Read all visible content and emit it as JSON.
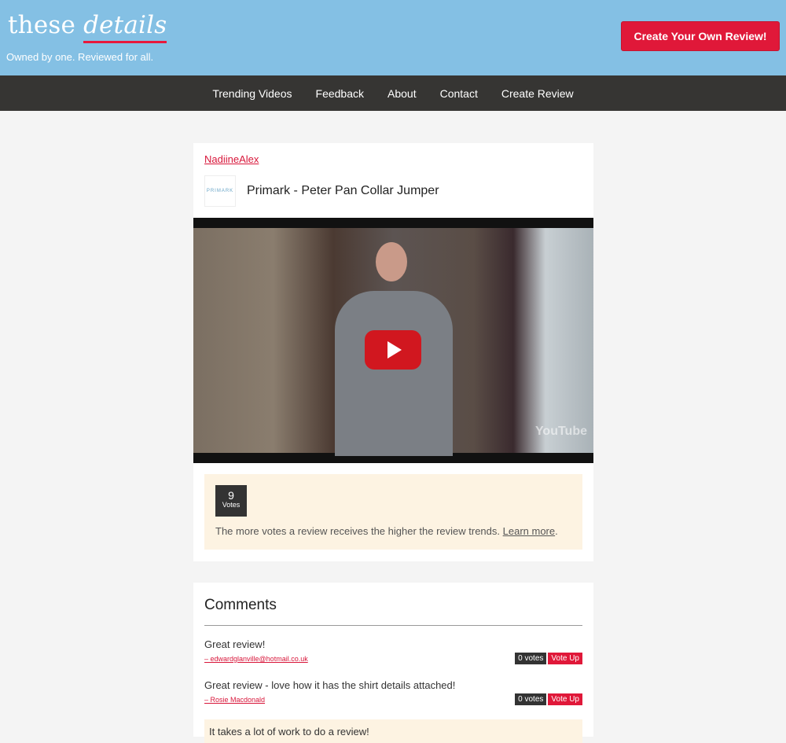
{
  "header": {
    "logo_plain": "these",
    "logo_italic": "details",
    "tagline": "Owned by one. Reviewed for all.",
    "cta_label": "Create Your Own Review!"
  },
  "nav": {
    "items": [
      "Trending Videos",
      "Feedback",
      "About",
      "Contact",
      "Create Review"
    ]
  },
  "review": {
    "author": "NadiineAlex",
    "brand_logo_text": "PRIMARK",
    "title": "Primark - Peter Pan Collar Jumper",
    "video_watermark": "YouTube",
    "votes": {
      "count": "9",
      "label": "Votes",
      "text": "The more votes a review receives the higher the review trends.",
      "link": "Learn more",
      "suffix": "."
    }
  },
  "comments": {
    "heading": "Comments",
    "items": [
      {
        "text": "Great review!",
        "author": "– edwardglanville@hotmail.co.uk",
        "votes": "0 votes",
        "vote_button": "Vote Up"
      },
      {
        "text": "Great review - love how it has the shirt details attached!",
        "author": "– Rosie Macdonald",
        "votes": "0 votes",
        "vote_button": "Vote Up"
      }
    ],
    "note": "It takes a lot of work to do a review!"
  },
  "colors": {
    "header_bg": "#84c0e4",
    "nav_bg": "#363533",
    "accent": "#e01839",
    "panel_bg": "#fdf3e2"
  }
}
